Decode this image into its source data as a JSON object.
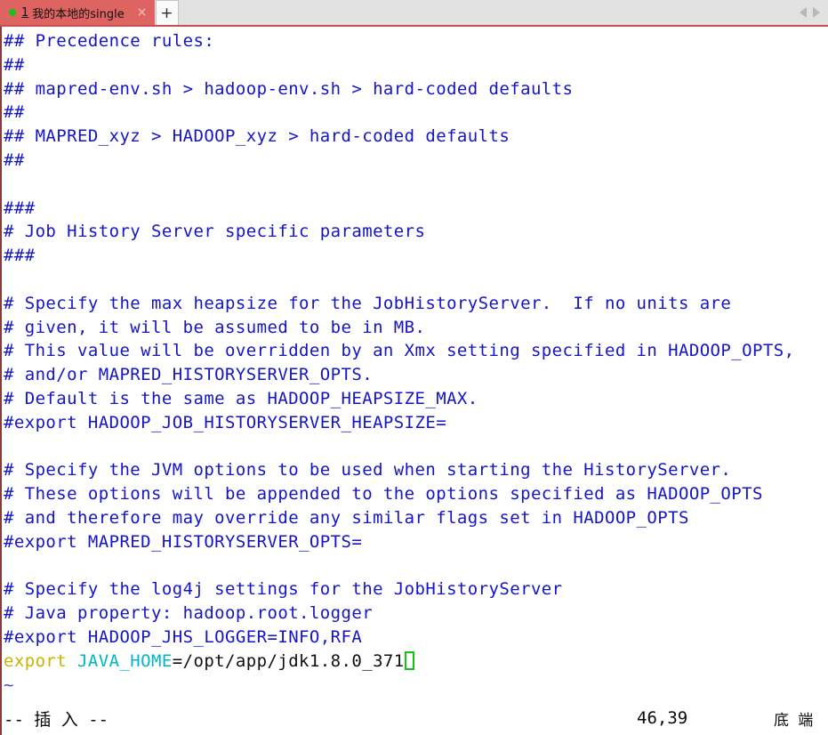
{
  "window": {
    "tabbar": {
      "accent_color": "#dd6461",
      "underline_color": "#c9504f",
      "background": "#e2e2e2",
      "tabs": [
        {
          "index": "1",
          "title": "我的本地的single",
          "close_label": "×",
          "status_dot": "connected"
        }
      ],
      "new_tab_label": "+",
      "nav_prev_label": "previous-tab",
      "nav_next_label": "next-tab"
    }
  },
  "editor": {
    "app": "vim",
    "text_color": "#1414c8",
    "cursor_color": "#13c413",
    "lines": [
      "## Precedence rules:",
      "##",
      "## mapred-env.sh > hadoop-env.sh > hard-coded defaults",
      "##",
      "## MAPRED_xyz > HADOOP_xyz > hard-coded defaults",
      "##",
      "",
      "###",
      "# Job History Server specific parameters",
      "###",
      "",
      "# Specify the max heapsize for the JobHistoryServer.  If no units are",
      "# given, it will be assumed to be in MB.",
      "# This value will be overridden by an Xmx setting specified in HADOOP_OPTS,",
      "# and/or MAPRED_HISTORYSERVER_OPTS.",
      "# Default is the same as HADOOP_HEAPSIZE_MAX.",
      "#export HADOOP_JOB_HISTORYSERVER_HEAPSIZE=",
      "",
      "# Specify the JVM options to be used when starting the HistoryServer.",
      "# These options will be appended to the options specified as HADOOP_OPTS",
      "# and therefore may override any similar flags set in HADOOP_OPTS",
      "#export MAPRED_HISTORYSERVER_OPTS=",
      "",
      "# Specify the log4j settings for the JobHistoryServer",
      "# Java property: hadoop.root.logger",
      "#export HADOOP_JHS_LOGGER=INFO,RFA"
    ],
    "export_line": {
      "keyword": "export",
      "space": " ",
      "variable": "JAVA_HOME",
      "value": "=/opt/app/jdk1.8.0_371",
      "keyword_color": "#c8b400",
      "variable_color": "#00b8c0",
      "value_color": "#101010"
    },
    "empty_marker": "~"
  },
  "statusline": {
    "mode": "-- 插 入 --",
    "position": "46,39",
    "location": "底 端"
  }
}
